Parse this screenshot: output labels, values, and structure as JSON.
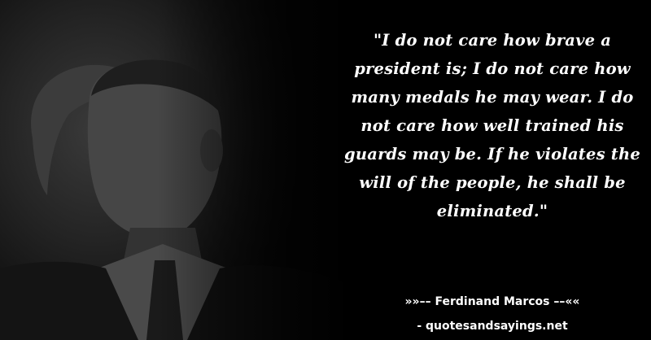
{
  "quote": {
    "text": "\"I do not care how brave a president is; I do not care how many medals he may wear. I do not care how well trained his guards may be. If he violates the will of the people, he shall be eliminated.\""
  },
  "attribution": {
    "author_line": "»»–– Ferdinand Marcos ––««",
    "source_line": "- quotesandsayings.net"
  },
  "colors": {
    "background": "#000000",
    "text": "#ffffff"
  }
}
